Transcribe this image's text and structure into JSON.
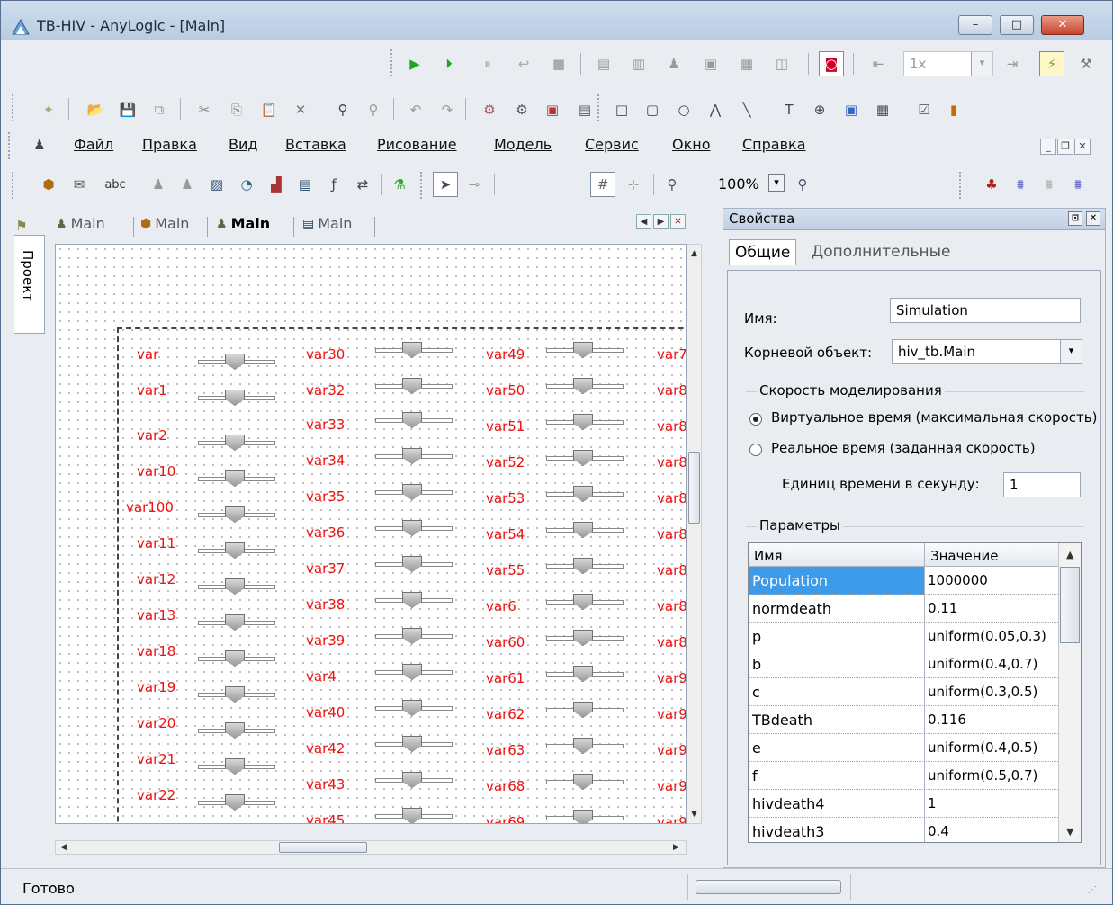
{
  "window": {
    "title": "TB-HIV - AnyLogic - [Main]",
    "minimize": "–",
    "restore": "□",
    "close": "✕"
  },
  "toolbar_run": {
    "zoom_factor": "1x"
  },
  "menu": {
    "items": [
      "Файл",
      "Правка",
      "Вид",
      "Вставка",
      "Рисование",
      "Модель",
      "Сервис",
      "Окно",
      "Справка"
    ]
  },
  "toolbar_view": {
    "zoom": "100%",
    "text_tool": "abc"
  },
  "sidebar": {
    "project_tab": "Проект"
  },
  "editor": {
    "tabs": [
      "Main",
      "Main",
      "Main",
      "Main"
    ],
    "columns": [
      [
        "var",
        "var1",
        "var2",
        "var10",
        "var100",
        "var11",
        "var12",
        "var13",
        "var18",
        "var19",
        "var20",
        "var21",
        "var22"
      ],
      [
        "var30",
        "var32",
        "var33",
        "var34",
        "var35",
        "var36",
        "var37",
        "var38",
        "var39",
        "var4",
        "var40",
        "var42",
        "var43",
        "var45"
      ],
      [
        "var49",
        "var50",
        "var51",
        "var52",
        "var53",
        "var54",
        "var55",
        "var6",
        "var60",
        "var61",
        "var62",
        "var63",
        "var68",
        "var69"
      ],
      [
        "var7",
        "var8",
        "var8",
        "var8",
        "var8",
        "var8",
        "var8",
        "var8",
        "var8",
        "var9",
        "var9",
        "var9",
        "var9",
        "var9"
      ]
    ]
  },
  "properties": {
    "title": "Свойства",
    "tabs": [
      "Общие",
      "Дополнительные"
    ],
    "name_label": "Имя:",
    "name_value": "Simulation",
    "root_label": "Корневой объект:",
    "root_value": "hiv_tb.Main",
    "speed_group": "Скорость моделирования",
    "virtual_time": "Виртуальное время (максимальная скорость)",
    "real_time": "Реальное время (заданная скорость)",
    "units_label": "Единиц времени в секунду:",
    "units_value": "1",
    "params_group": "Параметры",
    "table_headers": [
      "Имя",
      "Значение"
    ],
    "params": [
      {
        "name": "Population",
        "value": "1000000"
      },
      {
        "name": "normdeath",
        "value": "0.11"
      },
      {
        "name": "p",
        "value": "uniform(0.05,0.3)"
      },
      {
        "name": "b",
        "value": "uniform(0.4,0.7)"
      },
      {
        "name": "c",
        "value": "uniform(0.3,0.5)"
      },
      {
        "name": "TBdeath",
        "value": "0.116"
      },
      {
        "name": "e",
        "value": "uniform(0.4,0.5)"
      },
      {
        "name": "f",
        "value": "uniform(0.5,0.7)"
      },
      {
        "name": "hivdeath4",
        "value": "1"
      },
      {
        "name": "hivdeath3",
        "value": "0.4"
      }
    ]
  },
  "status": {
    "text": "Готово"
  }
}
